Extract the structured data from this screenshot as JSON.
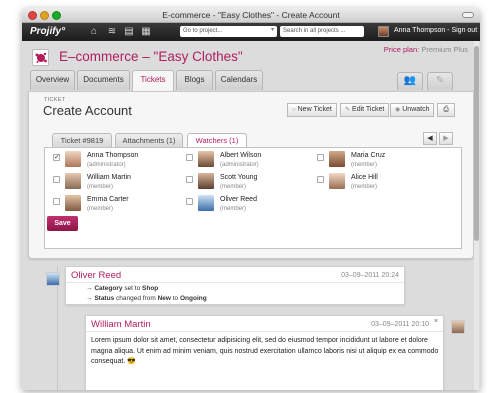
{
  "window": {
    "title": "E-commerce - \"Easy Clothes\" - Create Account"
  },
  "appbar": {
    "logo": "Projify°",
    "icons": [
      "home-icon",
      "broadcast-icon",
      "document-icon",
      "calendar-icon"
    ],
    "project_search_placeholder": "Go to project...",
    "search_placeholder": "Search in all projects ...",
    "user_signout": "Anna Thompson - Sign out"
  },
  "project": {
    "title": "E–commerce – \"Easy Clothes\"",
    "plan_label": "Price plan:",
    "plan_value": "Premium Plus"
  },
  "tabs": [
    {
      "label": "Overview",
      "active": false
    },
    {
      "label": "Documents",
      "active": false
    },
    {
      "label": "Tickets",
      "active": true
    },
    {
      "label": "Blogs",
      "active": false
    },
    {
      "label": "Calendars",
      "active": false
    }
  ],
  "ticket": {
    "crumb": "TICKET",
    "title": "Create Account",
    "buttons": {
      "new": "New Ticket",
      "edit": "Edit Ticket",
      "unwatch": "Unwatch"
    },
    "subtabs": [
      {
        "label": "Ticket #9819",
        "active": false
      },
      {
        "label": "Attachments (1)",
        "active": false
      },
      {
        "label": "Watchers (1)",
        "active": true
      }
    ],
    "members": [
      {
        "name": "Anna Thompson",
        "role": "(administrator)",
        "checked": true
      },
      {
        "name": "Albert Wilson",
        "role": "(administrator)",
        "checked": false
      },
      {
        "name": "Maria Cruz",
        "role": "(member)",
        "checked": false
      },
      {
        "name": "William Martin",
        "role": "(member)",
        "checked": false
      },
      {
        "name": "Scott Young",
        "role": "(member)",
        "checked": false
      },
      {
        "name": "Alice Hill",
        "role": "(member)",
        "checked": false
      },
      {
        "name": "Emma Carter",
        "role": "(member)",
        "checked": false
      },
      {
        "name": "Oliver Reed",
        "role": "(member)",
        "checked": false
      }
    ],
    "save": "Save"
  },
  "timeline": {
    "entry1": {
      "author": "Oliver Reed",
      "date": "03–09–2011 20:24",
      "change1": {
        "field": "Category",
        "verb": "set to",
        "value": "Shop"
      },
      "change2": {
        "field": "Status",
        "verb": "changed from",
        "from": "New",
        "to_word": "to",
        "to": "Ongoing"
      }
    },
    "entry2": {
      "author": "William Martin",
      "date": "03–09–2011 20:10",
      "close": "×",
      "body": "Lorem ipsum dolor sit amet, consectetur adipisicing elit, sed do eiusmod tempor incididunt ut labore et dolore magna aliqua. Ut enim ad minim veniam, quis nostrud exercitation ullamco laboris nisi ut aliquip ex ea commodo consequat. 😎"
    }
  },
  "colors": {
    "accent": "#b01e5c",
    "appbar": "#2a2a2a",
    "background": "#dcdcdc"
  }
}
